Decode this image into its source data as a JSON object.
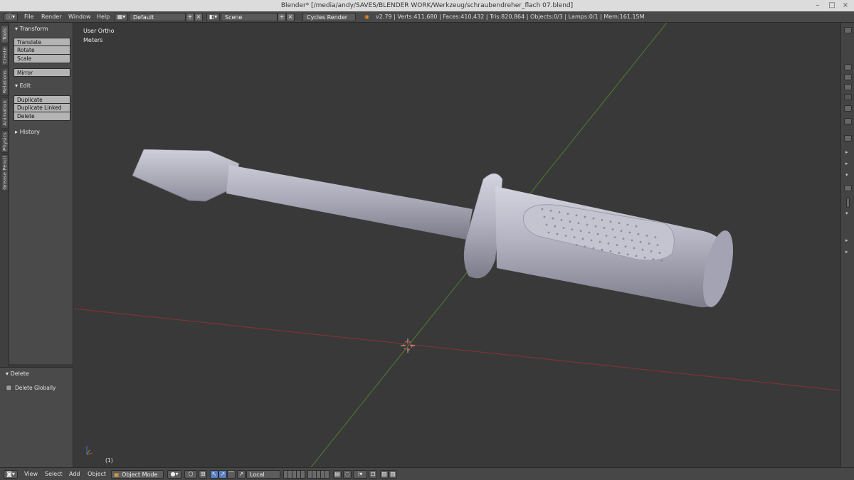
{
  "window": {
    "title": "Blender* [/media/andy/SAVES/BLENDER WORK/Werkzeug/schraubendreher_flach 07.blend]",
    "minimize": "–",
    "maximize": "□",
    "close": "×"
  },
  "info": {
    "menus": [
      "File",
      "Render",
      "Window",
      "Help"
    ],
    "layout": "Default",
    "scene": "Scene",
    "engine": "Cycles Render",
    "stats": "v2.79 | Verts:411,680 | Faces:410,432 | Tris:820,864 | Objects:0/3 | Lamps:0/1 | Mem:161.15M"
  },
  "tabs": [
    "Tools",
    "Create",
    "Relations",
    "Animation",
    "Physics",
    "Grease Pencil"
  ],
  "toolshelf": {
    "transform_header": "Transform",
    "translate": "Translate",
    "rotate": "Rotate",
    "scale": "Scale",
    "mirror": "Mirror",
    "edit_header": "Edit",
    "duplicate": "Duplicate",
    "duplicate_linked": "Duplicate Linked",
    "delete": "Delete",
    "history_header": "History"
  },
  "operator": {
    "header": "Delete",
    "delete_globally": "Delete Globally",
    "delete_globally_checked": false
  },
  "viewport": {
    "view_name": "User Ortho",
    "units": "Meters",
    "frame": "(1)",
    "object": "screwdriver",
    "colors": {
      "background": "#393939",
      "x_axis": "#8a3232",
      "y_axis": "#4f7f2f",
      "cursor": "#d24c3c"
    }
  },
  "bottombar": {
    "menus": [
      "View",
      "Select",
      "Add",
      "Object"
    ],
    "mode": "Object Mode",
    "pivot": "Local"
  },
  "icons": [
    "blender-info-icon",
    "screen-layout-icon",
    "scene-icon",
    "blender-logo-icon",
    "view3d-editor-icon",
    "object-mode-icon",
    "viewport-shading-icon",
    "pivot-point-icon",
    "manipulator-icon",
    "translate-manipulator-icon",
    "rotate-manipulator-icon",
    "scale-manipulator-icon",
    "orientation-icon",
    "layers-icon",
    "lock-camera-icon",
    "snap-icon",
    "proportional-edit-icon",
    "render-icon",
    "gizmo-axes-icon"
  ]
}
